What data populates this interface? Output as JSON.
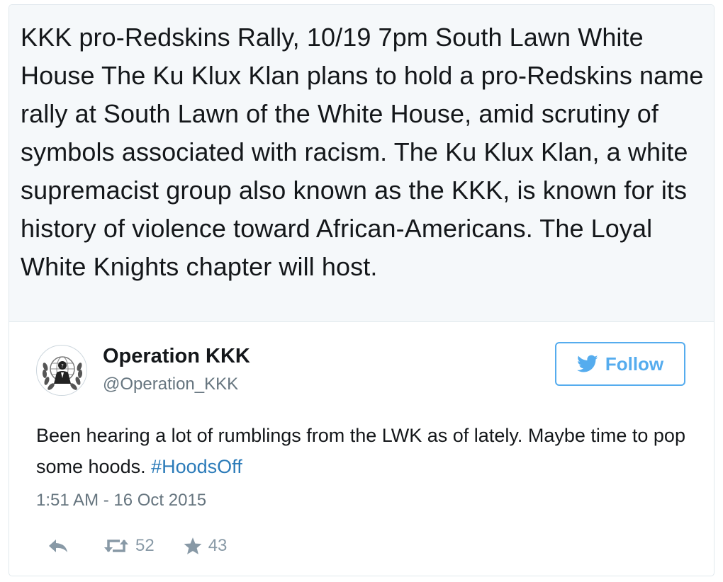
{
  "quote": {
    "text": "KKK pro-Redskins Rally, 10/19 7pm South Lawn White House The Ku Klux Klan plans to hold a pro-Redskins name rally at South Lawn of the White House, amid scrutiny of symbols associated with racism. The Ku Klux Klan, a white supremacist group also known as the KKK, is known for its history of violence toward African-Americans. The Loyal White Knights chapter will host."
  },
  "tweet": {
    "display_name": "Operation KKK",
    "handle": "@Operation_KKK",
    "follow_label": "Follow",
    "body": "Been hearing a lot of rumblings from the LWK as of lately. Maybe time to pop some hoods.",
    "hashtag": "#HoodsOff",
    "timestamp": "1:51 AM - 16 Oct 2015",
    "retweet_count": "52",
    "favorite_count": "43"
  },
  "icons": {
    "reply": "reply-icon",
    "retweet": "retweet-icon",
    "favorite": "star-icon",
    "follow": "bird-icon",
    "avatar": "anonymous-logo"
  },
  "colors": {
    "accent": "#55acee",
    "link": "#2b7bb9",
    "muted": "#66757f",
    "quote_bg": "#f5f8fa",
    "border": "#e1e8ed"
  }
}
